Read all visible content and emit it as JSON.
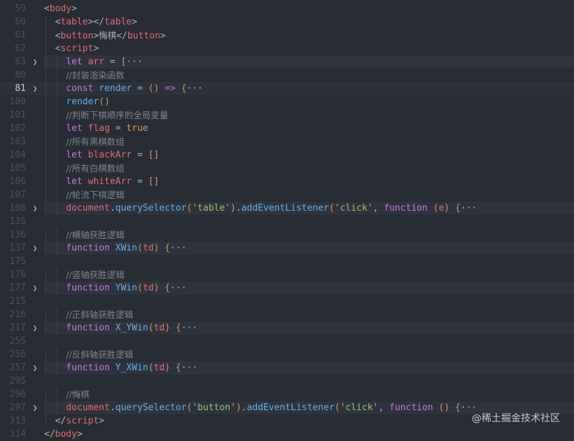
{
  "editor": {
    "lines": [
      {
        "n": "59",
        "tokens": [
          {
            "c": "t-punc",
            "t": "<"
          },
          {
            "c": "t-tag",
            "t": "body"
          },
          {
            "c": "t-punc",
            "t": ">"
          }
        ]
      },
      {
        "n": "60",
        "tokens": [
          {
            "c": "t-punc",
            "t": "  <"
          },
          {
            "c": "t-tag",
            "t": "table"
          },
          {
            "c": "t-punc",
            "t": "></"
          },
          {
            "c": "t-tag",
            "t": "table"
          },
          {
            "c": "t-punc",
            "t": ">"
          }
        ]
      },
      {
        "n": "61",
        "tokens": [
          {
            "c": "t-punc",
            "t": "  <"
          },
          {
            "c": "t-tag",
            "t": "button"
          },
          {
            "c": "t-punc",
            "t": ">"
          },
          {
            "c": "t-cn",
            "t": "悔棋"
          },
          {
            "c": "t-punc",
            "t": "</"
          },
          {
            "c": "t-tag",
            "t": "button"
          },
          {
            "c": "t-punc",
            "t": ">"
          }
        ]
      },
      {
        "n": "62",
        "tokens": [
          {
            "c": "t-punc",
            "t": "  <"
          },
          {
            "c": "t-tag",
            "t": "script"
          },
          {
            "c": "t-punc",
            "t": ">"
          }
        ]
      },
      {
        "n": "63",
        "fold": true,
        "foldhl": true,
        "tokens": [
          {
            "c": "t-punc",
            "t": "    "
          },
          {
            "c": "t-kw",
            "t": "let"
          },
          {
            "c": "t-punc",
            "t": " "
          },
          {
            "c": "t-var",
            "t": "arr"
          },
          {
            "c": "t-punc",
            "t": " = "
          },
          {
            "c": "t-br",
            "t": "["
          },
          {
            "c": "t-ell",
            "t": "···"
          }
        ]
      },
      {
        "n": "80",
        "tokens": [
          {
            "c": "t-punc",
            "t": "    "
          },
          {
            "c": "t-cm",
            "t": "//封装渲染函数"
          }
        ]
      },
      {
        "n": "81",
        "fold": true,
        "current": true,
        "tokens": [
          {
            "c": "t-punc",
            "t": "    "
          },
          {
            "c": "t-kw",
            "t": "const"
          },
          {
            "c": "t-punc",
            "t": " "
          },
          {
            "c": "t-fn",
            "t": "render"
          },
          {
            "c": "t-punc",
            "t": " = "
          },
          {
            "c": "t-br",
            "t": "()"
          },
          {
            "c": "t-punc",
            "t": " "
          },
          {
            "c": "t-kw",
            "t": "=>"
          },
          {
            "c": "t-punc",
            "t": " "
          },
          {
            "c": "t-br",
            "t": "{"
          },
          {
            "c": "t-ell",
            "t": "···"
          }
        ]
      },
      {
        "n": "100",
        "tokens": [
          {
            "c": "t-punc",
            "t": "    "
          },
          {
            "c": "t-fn",
            "t": "render"
          },
          {
            "c": "t-br",
            "t": "()"
          }
        ]
      },
      {
        "n": "101",
        "tokens": [
          {
            "c": "t-punc",
            "t": "    "
          },
          {
            "c": "t-cm",
            "t": "//判断下棋顺序的全局变量"
          }
        ]
      },
      {
        "n": "102",
        "tokens": [
          {
            "c": "t-punc",
            "t": "    "
          },
          {
            "c": "t-kw",
            "t": "let"
          },
          {
            "c": "t-punc",
            "t": " "
          },
          {
            "c": "t-var",
            "t": "flag"
          },
          {
            "c": "t-punc",
            "t": " = "
          },
          {
            "c": "t-bool",
            "t": "true"
          }
        ]
      },
      {
        "n": "103",
        "tokens": [
          {
            "c": "t-punc",
            "t": "    "
          },
          {
            "c": "t-cm",
            "t": "//所有黑棋数组"
          }
        ]
      },
      {
        "n": "104",
        "tokens": [
          {
            "c": "t-punc",
            "t": "    "
          },
          {
            "c": "t-kw",
            "t": "let"
          },
          {
            "c": "t-punc",
            "t": " "
          },
          {
            "c": "t-var",
            "t": "blackArr"
          },
          {
            "c": "t-punc",
            "t": " = "
          },
          {
            "c": "t-br",
            "t": "[]"
          }
        ]
      },
      {
        "n": "105",
        "tokens": [
          {
            "c": "t-punc",
            "t": "    "
          },
          {
            "c": "t-cm",
            "t": "//所有白棋数组"
          }
        ]
      },
      {
        "n": "106",
        "tokens": [
          {
            "c": "t-punc",
            "t": "    "
          },
          {
            "c": "t-kw",
            "t": "let"
          },
          {
            "c": "t-punc",
            "t": " "
          },
          {
            "c": "t-var",
            "t": "whiteArr"
          },
          {
            "c": "t-punc",
            "t": " = "
          },
          {
            "c": "t-br",
            "t": "[]"
          }
        ]
      },
      {
        "n": "107",
        "tokens": [
          {
            "c": "t-punc",
            "t": "    "
          },
          {
            "c": "t-cm",
            "t": "//轮流下棋逻辑"
          }
        ]
      },
      {
        "n": "108",
        "fold": true,
        "foldhl": true,
        "tokens": [
          {
            "c": "t-punc",
            "t": "    "
          },
          {
            "c": "t-tag",
            "t": "document"
          },
          {
            "c": "t-punc",
            "t": "."
          },
          {
            "c": "t-fn",
            "t": "querySelector"
          },
          {
            "c": "t-br",
            "t": "("
          },
          {
            "c": "t-str",
            "t": "'table'"
          },
          {
            "c": "t-br",
            "t": ")"
          },
          {
            "c": "t-punc",
            "t": "."
          },
          {
            "c": "t-fn",
            "t": "addEventListener"
          },
          {
            "c": "t-br",
            "t": "("
          },
          {
            "c": "t-str",
            "t": "'click'"
          },
          {
            "c": "t-punc",
            "t": ", "
          },
          {
            "c": "t-kw",
            "t": "function"
          },
          {
            "c": "t-punc",
            "t": " "
          },
          {
            "c": "t-br",
            "t": "("
          },
          {
            "c": "t-param",
            "t": "e"
          },
          {
            "c": "t-br",
            "t": ")"
          },
          {
            "c": "t-punc",
            "t": " "
          },
          {
            "c": "t-br",
            "t": "{"
          },
          {
            "c": "t-ell",
            "t": "···"
          }
        ]
      },
      {
        "n": "135",
        "tokens": []
      },
      {
        "n": "136",
        "tokens": [
          {
            "c": "t-punc",
            "t": "    "
          },
          {
            "c": "t-cm",
            "t": "//横轴获胜逻辑"
          }
        ]
      },
      {
        "n": "137",
        "fold": true,
        "foldhl": true,
        "tokens": [
          {
            "c": "t-punc",
            "t": "    "
          },
          {
            "c": "t-kw",
            "t": "function"
          },
          {
            "c": "t-punc",
            "t": " "
          },
          {
            "c": "t-fn",
            "t": "XWin"
          },
          {
            "c": "t-br",
            "t": "("
          },
          {
            "c": "t-param",
            "t": "td"
          },
          {
            "c": "t-br",
            "t": ")"
          },
          {
            "c": "t-punc",
            "t": " "
          },
          {
            "c": "t-br",
            "t": "{"
          },
          {
            "c": "t-ell",
            "t": "···"
          }
        ]
      },
      {
        "n": "175",
        "tokens": []
      },
      {
        "n": "176",
        "tokens": [
          {
            "c": "t-punc",
            "t": "    "
          },
          {
            "c": "t-cm",
            "t": "//竖轴获胜逻辑"
          }
        ]
      },
      {
        "n": "177",
        "fold": true,
        "foldhl": true,
        "tokens": [
          {
            "c": "t-punc",
            "t": "    "
          },
          {
            "c": "t-kw",
            "t": "function"
          },
          {
            "c": "t-punc",
            "t": " "
          },
          {
            "c": "t-fn",
            "t": "YWin"
          },
          {
            "c": "t-br",
            "t": "("
          },
          {
            "c": "t-param",
            "t": "td"
          },
          {
            "c": "t-br",
            "t": ")"
          },
          {
            "c": "t-punc",
            "t": " "
          },
          {
            "c": "t-br",
            "t": "{"
          },
          {
            "c": "t-ell",
            "t": "···"
          }
        ]
      },
      {
        "n": "215",
        "tokens": []
      },
      {
        "n": "216",
        "tokens": [
          {
            "c": "t-punc",
            "t": "    "
          },
          {
            "c": "t-cm",
            "t": "//正斜轴获胜逻辑"
          }
        ]
      },
      {
        "n": "217",
        "fold": true,
        "foldhl": true,
        "tokens": [
          {
            "c": "t-punc",
            "t": "    "
          },
          {
            "c": "t-kw",
            "t": "function"
          },
          {
            "c": "t-punc",
            "t": " "
          },
          {
            "c": "t-fn",
            "t": "X_YWin"
          },
          {
            "c": "t-br",
            "t": "("
          },
          {
            "c": "t-param",
            "t": "td"
          },
          {
            "c": "t-br",
            "t": ")"
          },
          {
            "c": "t-punc",
            "t": " "
          },
          {
            "c": "t-br",
            "t": "{"
          },
          {
            "c": "t-ell",
            "t": "···"
          }
        ]
      },
      {
        "n": "255",
        "tokens": []
      },
      {
        "n": "256",
        "tokens": [
          {
            "c": "t-punc",
            "t": "    "
          },
          {
            "c": "t-cm",
            "t": "//反斜轴获胜逻辑"
          }
        ]
      },
      {
        "n": "257",
        "fold": true,
        "foldhl": true,
        "tokens": [
          {
            "c": "t-punc",
            "t": "    "
          },
          {
            "c": "t-kw",
            "t": "function"
          },
          {
            "c": "t-punc",
            "t": " "
          },
          {
            "c": "t-fn",
            "t": "Y_XWin"
          },
          {
            "c": "t-br",
            "t": "("
          },
          {
            "c": "t-param",
            "t": "td"
          },
          {
            "c": "t-br",
            "t": ")"
          },
          {
            "c": "t-punc",
            "t": " "
          },
          {
            "c": "t-br",
            "t": "{"
          },
          {
            "c": "t-ell",
            "t": "···"
          }
        ]
      },
      {
        "n": "295",
        "tokens": []
      },
      {
        "n": "296",
        "tokens": [
          {
            "c": "t-punc",
            "t": "    "
          },
          {
            "c": "t-cm",
            "t": "//悔棋"
          }
        ]
      },
      {
        "n": "297",
        "fold": true,
        "foldhl": true,
        "tokens": [
          {
            "c": "t-punc",
            "t": "    "
          },
          {
            "c": "t-tag",
            "t": "document"
          },
          {
            "c": "t-punc",
            "t": "."
          },
          {
            "c": "t-fn",
            "t": "querySelector"
          },
          {
            "c": "t-br",
            "t": "("
          },
          {
            "c": "t-str",
            "t": "'button'"
          },
          {
            "c": "t-br",
            "t": ")"
          },
          {
            "c": "t-punc",
            "t": "."
          },
          {
            "c": "t-fn",
            "t": "addEventListener"
          },
          {
            "c": "t-br",
            "t": "("
          },
          {
            "c": "t-str",
            "t": "'click'"
          },
          {
            "c": "t-punc",
            "t": ", "
          },
          {
            "c": "t-kw",
            "t": "function"
          },
          {
            "c": "t-punc",
            "t": " "
          },
          {
            "c": "t-br",
            "t": "()"
          },
          {
            "c": "t-punc",
            "t": " "
          },
          {
            "c": "t-br",
            "t": "{"
          },
          {
            "c": "t-ell",
            "t": "···"
          }
        ]
      },
      {
        "n": "313",
        "tokens": [
          {
            "c": "t-punc",
            "t": "  </"
          },
          {
            "c": "t-tag",
            "t": "script"
          },
          {
            "c": "t-punc",
            "t": ">"
          }
        ]
      },
      {
        "n": "314",
        "tokens": [
          {
            "c": "t-punc",
            "t": "</"
          },
          {
            "c": "t-tag",
            "t": "body"
          },
          {
            "c": "t-punc",
            "t": ">"
          }
        ]
      }
    ]
  },
  "watermark": "@稀土掘金技术社区",
  "icons": {
    "fold": "chevron-right-icon"
  }
}
